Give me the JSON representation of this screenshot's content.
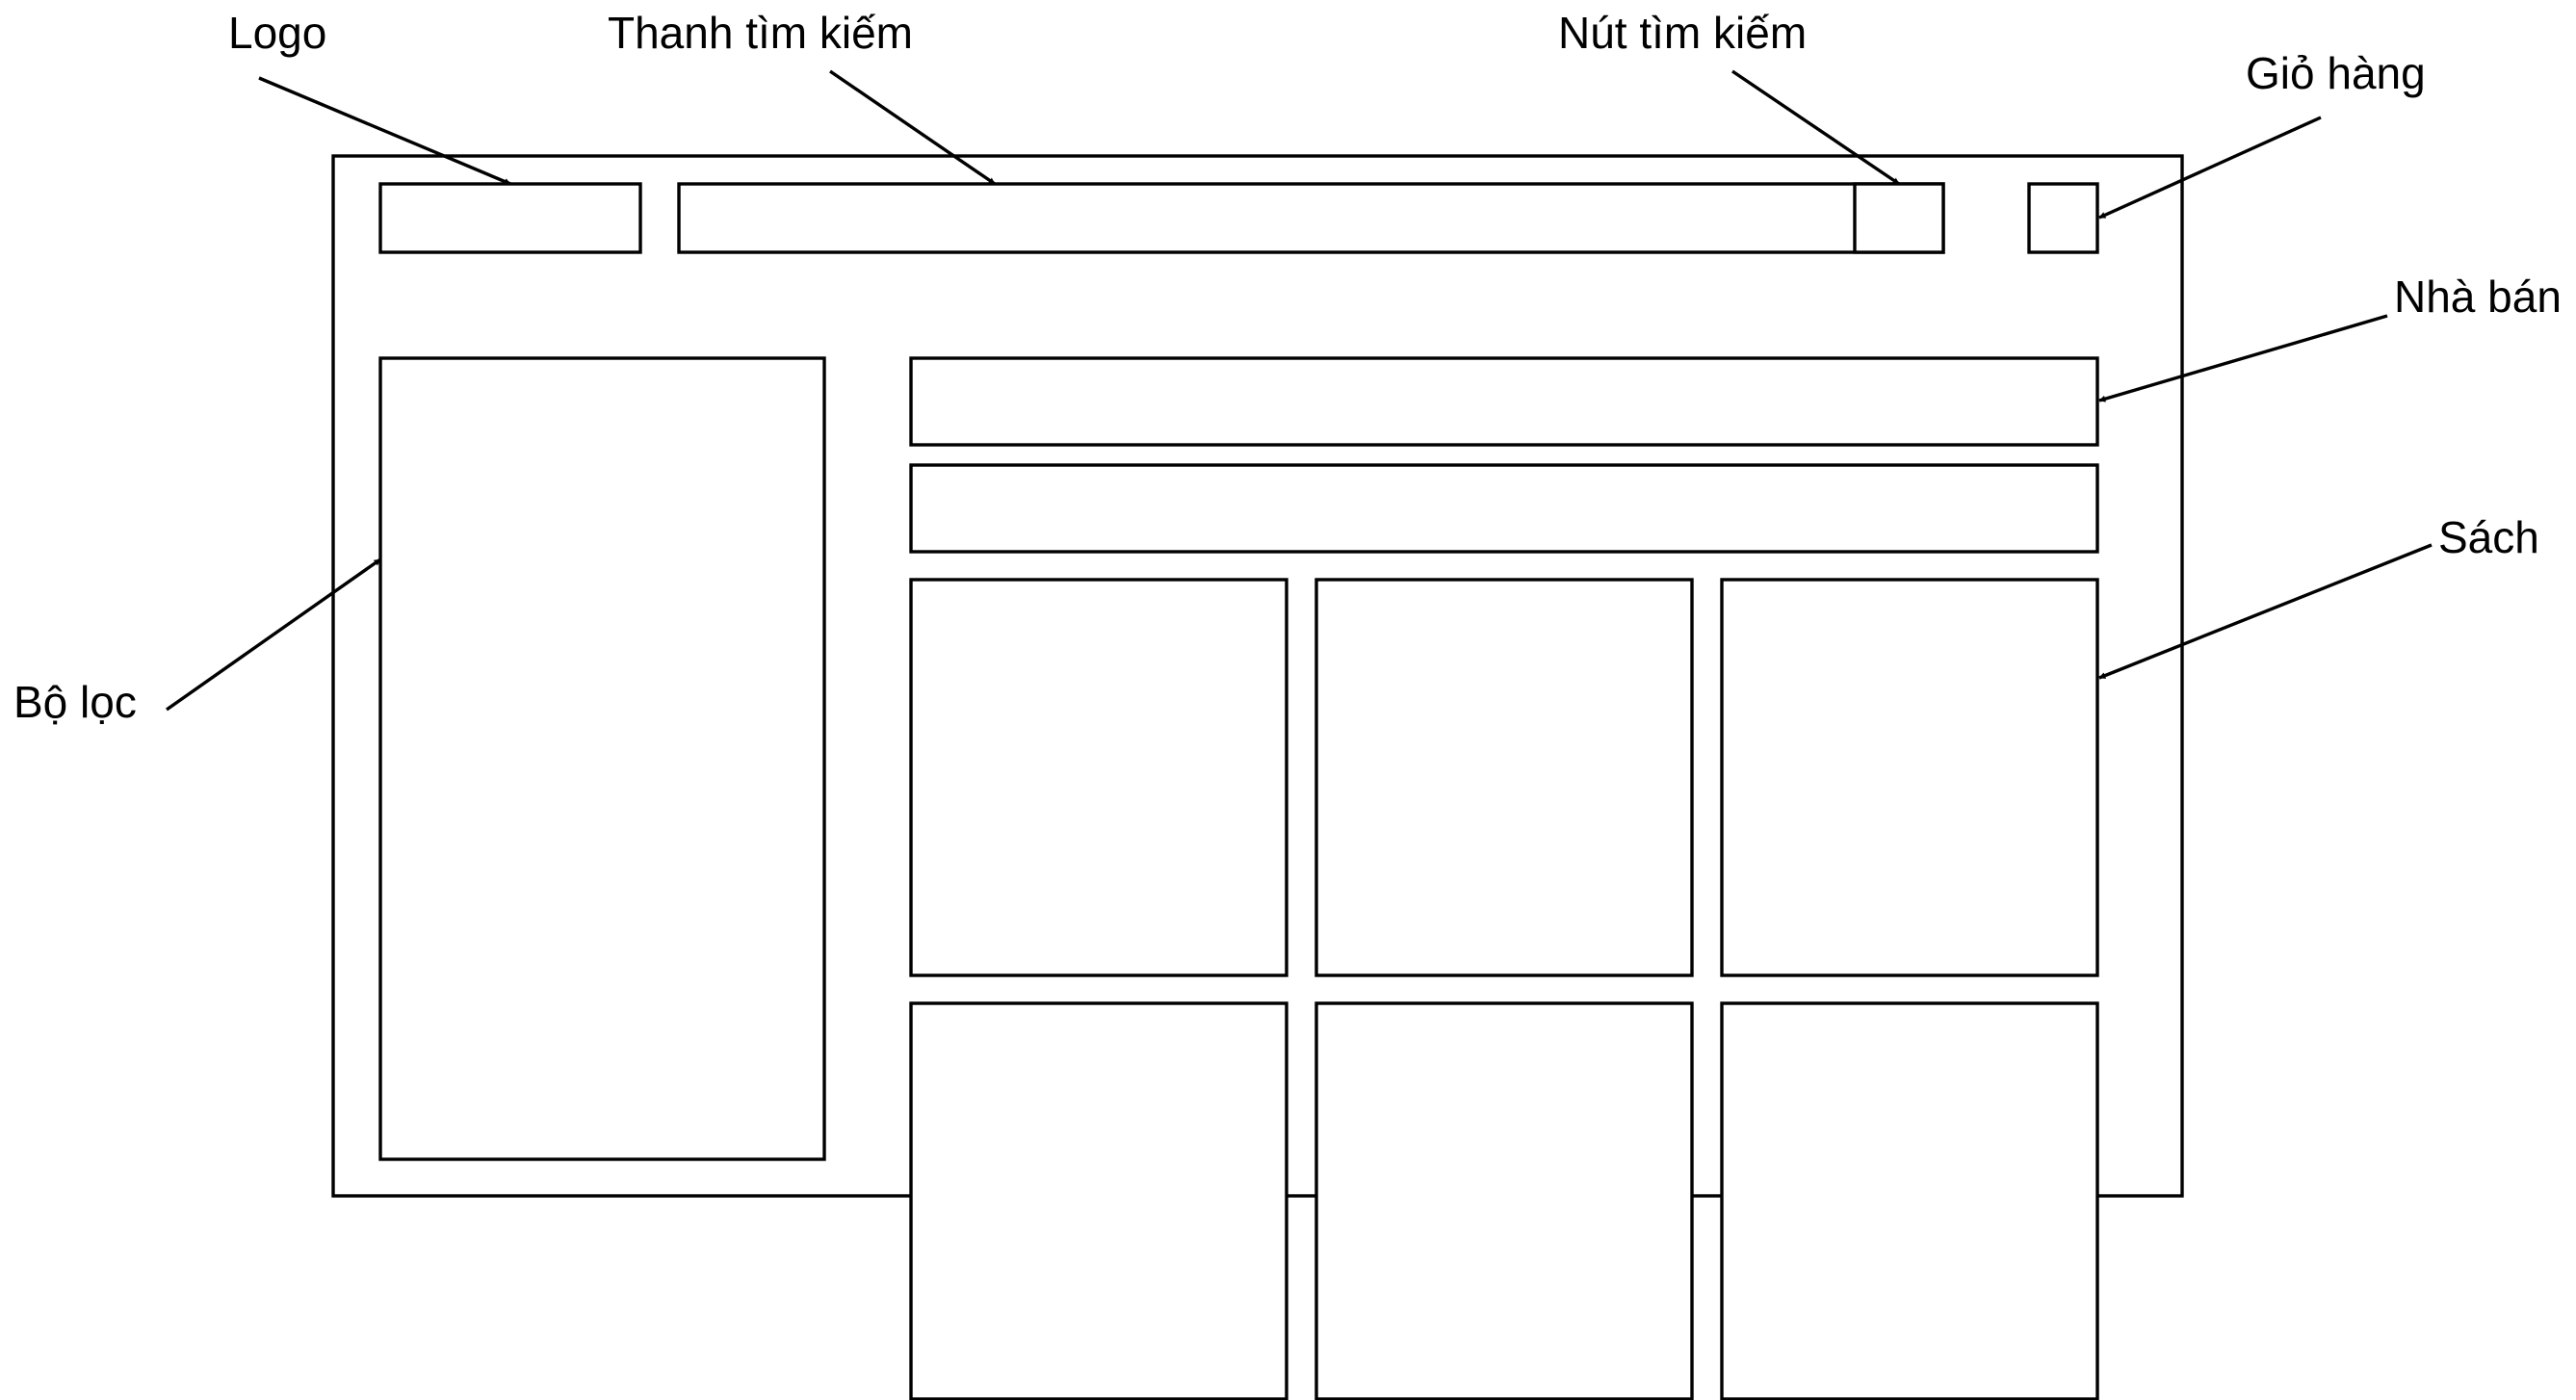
{
  "annotations": {
    "logo": "Logo",
    "search_bar": "Thanh tìm kiếm",
    "search_button": "Nút tìm kiếm",
    "cart": "Giỏ hàng",
    "seller": "Nhà bán",
    "books": "Sách",
    "filter": "Bộ lọc"
  },
  "colors": {
    "stroke": "#000000",
    "background": "#ffffff"
  }
}
